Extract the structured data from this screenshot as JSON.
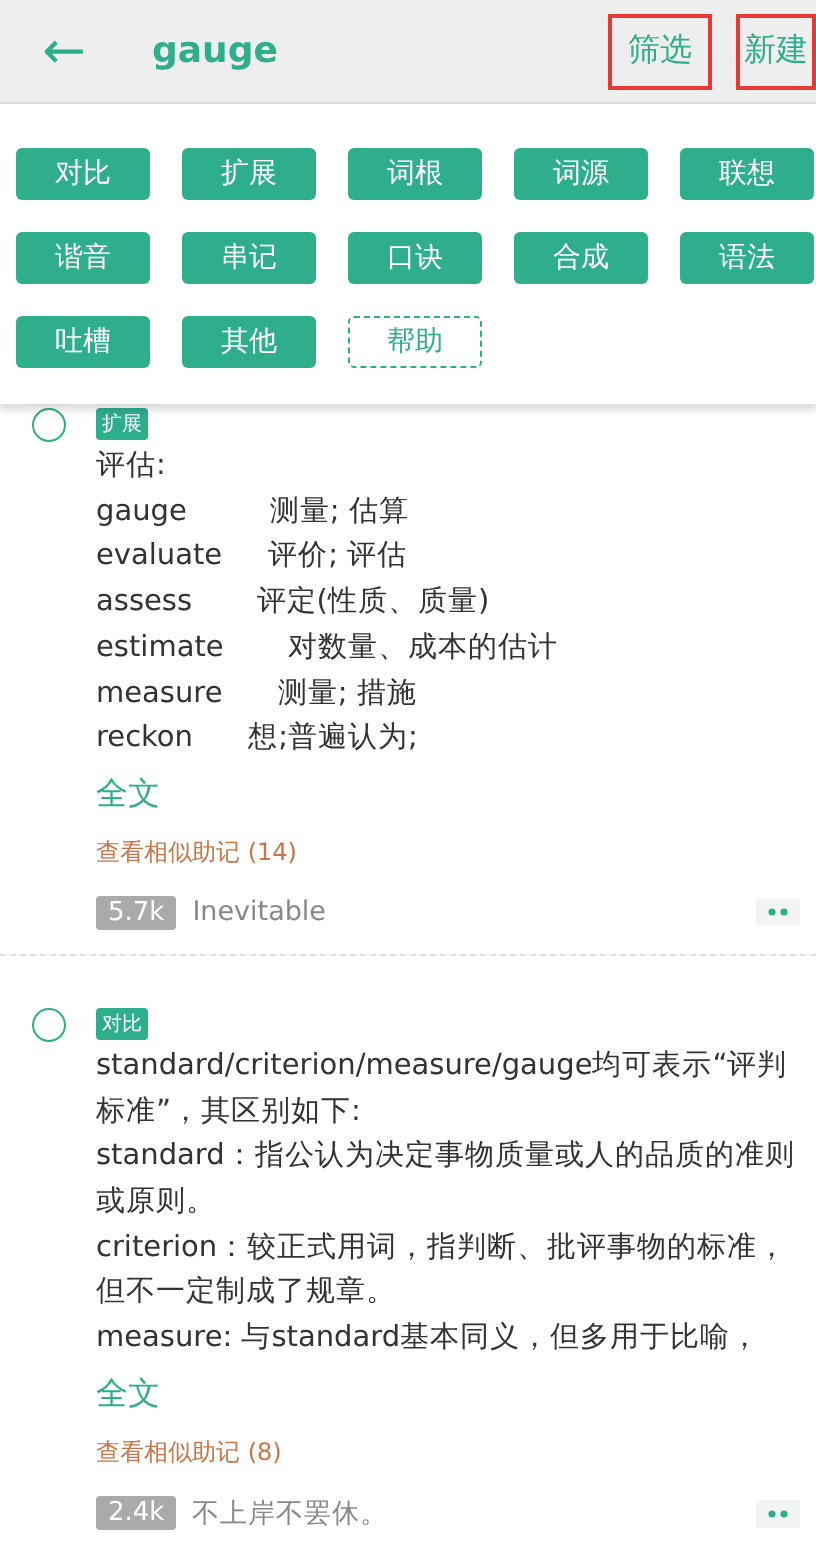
{
  "header": {
    "back": "←",
    "title": "gauge",
    "actions": [
      {
        "label": "筛选",
        "marked": true
      },
      {
        "label": "新建",
        "marked": true
      }
    ]
  },
  "categories": [
    {
      "label": "对比",
      "kind": "tag"
    },
    {
      "label": "扩展",
      "kind": "tag"
    },
    {
      "label": "词根",
      "kind": "tag"
    },
    {
      "label": "词源",
      "kind": "tag"
    },
    {
      "label": "联想",
      "kind": "tag"
    },
    {
      "label": "谐音",
      "kind": "tag"
    },
    {
      "label": "串记",
      "kind": "tag"
    },
    {
      "label": "口诀",
      "kind": "tag"
    },
    {
      "label": "合成",
      "kind": "tag"
    },
    {
      "label": "语法",
      "kind": "tag"
    },
    {
      "label": "吐槽",
      "kind": "tag"
    },
    {
      "label": "其他",
      "kind": "tag"
    },
    {
      "label": "帮助",
      "kind": "help"
    }
  ],
  "notes": [
    {
      "selected": false,
      "tag": "扩展",
      "lines": [
        "评估:",
        "gauge         测量; 估算",
        "evaluate     评价; 评估",
        "assess       评定(性质、质量)",
        "estimate       对数量、成本的估计",
        "measure      测量; 措施",
        "reckon      想;普遍认为;"
      ],
      "more": "全文",
      "similar": "查看相似助记 (14)",
      "count": "5.7k",
      "author": "Inevitable"
    },
    {
      "selected": false,
      "tag": "对比",
      "lines": [
        "standard/criterion/measure/gauge均可表示“评判标准”，其区别如下:",
        "standard：指公认为决定事物质量或人的品质的准则或原则。",
        "criterion：较正式用词，指判断、批评事物的标准，但不一定制成了规章。",
        "measure: 与standard基本同义，但多用于比喻，"
      ],
      "more": "全文",
      "similar": "查看相似助记 (8)",
      "count": "2.4k",
      "author": "不上岸不罢休。"
    }
  ]
}
